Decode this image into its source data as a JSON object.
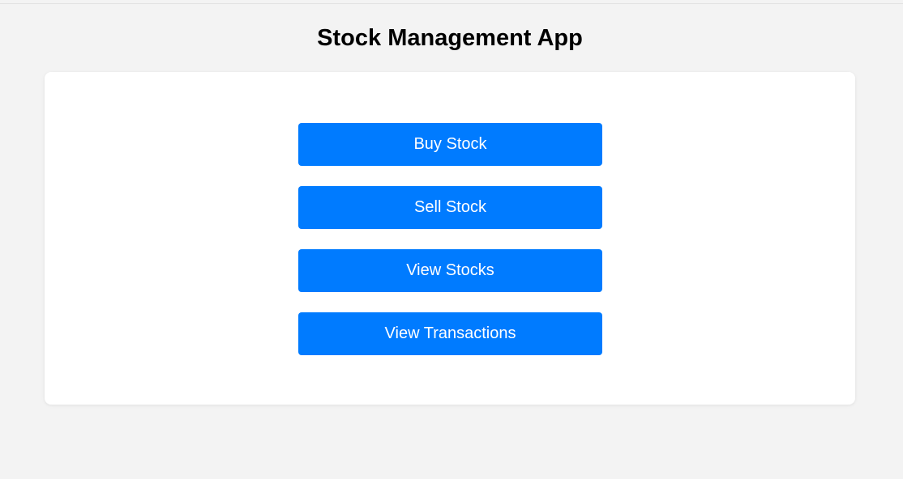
{
  "header": {
    "title": "Stock Management App"
  },
  "colors": {
    "background": "#f3f3f3",
    "card": "#ffffff",
    "button": "#007bff",
    "button_text": "#ffffff"
  },
  "menu": {
    "buttons": [
      {
        "label": "Buy Stock"
      },
      {
        "label": "Sell Stock"
      },
      {
        "label": "View Stocks"
      },
      {
        "label": "View Transactions"
      }
    ]
  }
}
